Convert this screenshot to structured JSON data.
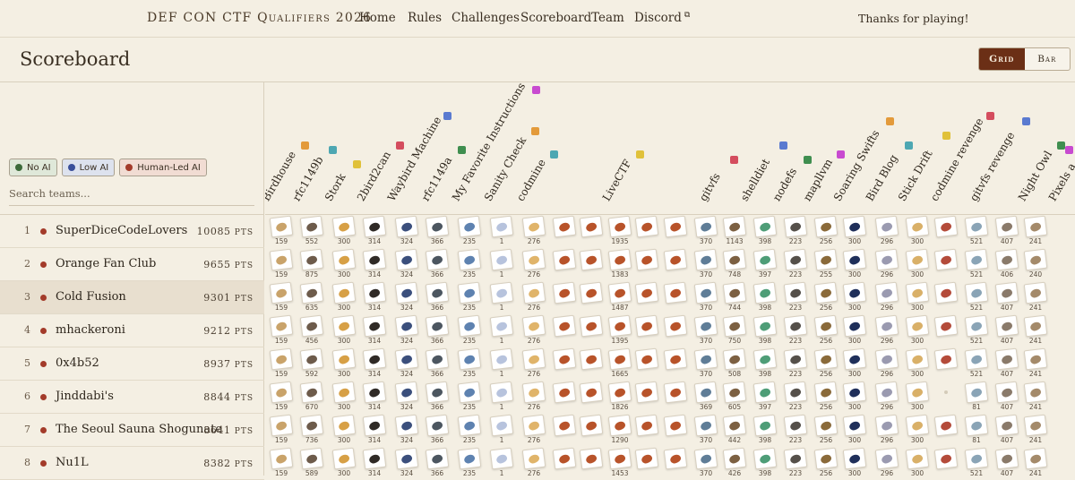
{
  "nav": {
    "brand": "DEF CON CTF Qualifiers 2026",
    "links": [
      "Home",
      "Rules",
      "Challenges",
      "Scoreboard",
      "Team",
      "Discord"
    ],
    "thanks": "Thanks for playing!"
  },
  "page": {
    "title": "Scoreboard",
    "view_grid": "Grid",
    "view_bar": "Bar"
  },
  "filters": {
    "no_ai": "No AI",
    "low_ai": "Low AI",
    "human_led": "Human-Led AI",
    "search_placeholder": "Search teams..."
  },
  "colors": {
    "accent": "#6b2f16",
    "no_ai": "#3c6a3a",
    "low_ai": "#3a4f9a",
    "human_led": "#a33b2a"
  },
  "teams": [
    {
      "rank": "1",
      "name": "SuperDiceCodeLovers",
      "points": "10085"
    },
    {
      "rank": "2",
      "name": "Orange Fan Club",
      "points": "9655"
    },
    {
      "rank": "3",
      "name": "Cold Fusion",
      "points": "9301"
    },
    {
      "rank": "4",
      "name": "mhackeroni",
      "points": "9212"
    },
    {
      "rank": "5",
      "name": "0x4b52",
      "points": "8937"
    },
    {
      "rank": "6",
      "name": "Jinddabi's",
      "points": "8844"
    },
    {
      "rank": "7",
      "name": "The Seoul Sauna Shogunate",
      "points": "8641"
    },
    {
      "rank": "8",
      "name": "Nu1L",
      "points": "8382"
    }
  ],
  "points_unit": "PTS",
  "challenges": [
    "Birdhouse",
    "rfc1149b",
    "Stork",
    "2bird2can",
    "Waybird Machine",
    "rfc1149a",
    "My Favorite Instructions",
    "Sanity Check",
    "codmine",
    "LiveCTF",
    "gitvfs",
    "shelldiet",
    "nodefs",
    "mapllvm",
    "Soaring Swifts",
    "Bird Blog",
    "Stick Drift",
    "codmine revenge",
    "gitvfs revenge",
    "Night Owl",
    "Pixels a"
  ],
  "scores": [
    [
      "159",
      "552",
      "300",
      "314",
      "324",
      "366",
      "235",
      "1",
      "276",
      "",
      "",
      "1935",
      "",
      "",
      "370",
      "1143",
      "398",
      "223",
      "256",
      "300",
      "296",
      "300",
      "",
      "521",
      "407",
      "241"
    ],
    [
      "159",
      "875",
      "300",
      "314",
      "324",
      "366",
      "235",
      "1",
      "276",
      "",
      "",
      "1383",
      "",
      "",
      "370",
      "748",
      "397",
      "223",
      "255",
      "300",
      "296",
      "300",
      "",
      "521",
      "406",
      "240"
    ],
    [
      "159",
      "635",
      "300",
      "314",
      "324",
      "366",
      "235",
      "1",
      "276",
      "",
      "",
      "1487",
      "",
      "",
      "370",
      "744",
      "398",
      "223",
      "256",
      "300",
      "296",
      "300",
      "",
      "521",
      "407",
      "241"
    ],
    [
      "159",
      "456",
      "300",
      "314",
      "324",
      "366",
      "235",
      "1",
      "276",
      "",
      "",
      "1395",
      "",
      "",
      "370",
      "750",
      "398",
      "223",
      "256",
      "300",
      "296",
      "300",
      "",
      "521",
      "407",
      "241"
    ],
    [
      "159",
      "592",
      "300",
      "314",
      "324",
      "366",
      "235",
      "1",
      "276",
      "",
      "",
      "1665",
      "",
      "",
      "370",
      "508",
      "398",
      "223",
      "256",
      "300",
      "296",
      "300",
      "",
      "521",
      "407",
      "241"
    ],
    [
      "159",
      "670",
      "300",
      "314",
      "324",
      "366",
      "235",
      "1",
      "276",
      "",
      "",
      "1826",
      "",
      "",
      "369",
      "605",
      "397",
      "223",
      "256",
      "300",
      "296",
      "300",
      "",
      "81",
      "407",
      "241"
    ],
    [
      "159",
      "736",
      "300",
      "314",
      "324",
      "366",
      "235",
      "1",
      "276",
      "",
      "",
      "1290",
      "",
      "",
      "370",
      "442",
      "398",
      "223",
      "256",
      "300",
      "296",
      "300",
      "",
      "81",
      "407",
      "241"
    ],
    [
      "159",
      "589",
      "300",
      "314",
      "324",
      "366",
      "235",
      "1",
      "276",
      "",
      "",
      "1453",
      "",
      "",
      "370",
      "426",
      "398",
      "223",
      "256",
      "300",
      "296",
      "300",
      "",
      "521",
      "407",
      "241"
    ]
  ]
}
